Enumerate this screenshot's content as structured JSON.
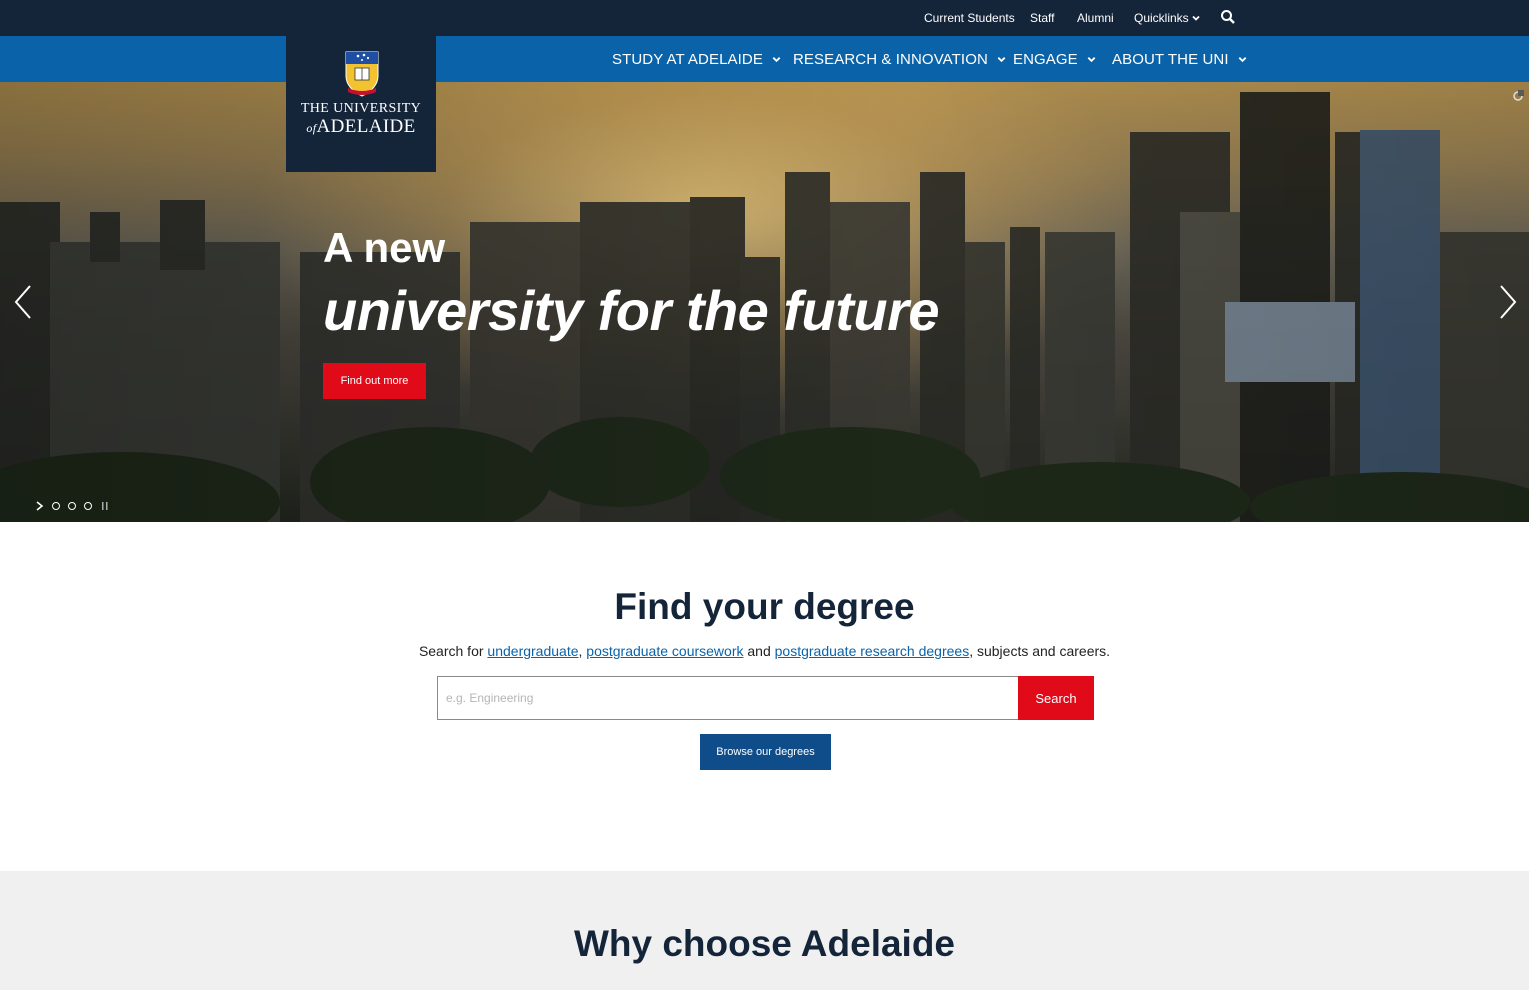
{
  "utility_nav": {
    "links": [
      "Current Students",
      "Staff",
      "Alumni"
    ],
    "quicklinks_label": "Quicklinks",
    "icons": [
      "chevron-down-icon",
      "search-icon"
    ]
  },
  "logo": {
    "line1": "THE UNIVERSITY",
    "line2_prefix": "of",
    "line2": "ADELAIDE"
  },
  "main_nav": {
    "items": [
      {
        "label": "STUDY AT ADELAIDE"
      },
      {
        "label": "RESEARCH & INNOVATION"
      },
      {
        "label": "ENGAGE"
      },
      {
        "label": "ABOUT THE UNI"
      }
    ]
  },
  "hero": {
    "title_line1": "A new",
    "title_line2": "university for the future",
    "button_label": "Find out more",
    "pager_count": 3,
    "icons": [
      "chevron-left-icon",
      "chevron-right-icon",
      "play-icon",
      "pause-icon"
    ]
  },
  "degree": {
    "title": "Find your degree",
    "desc_prefix": "Search for ",
    "link_undergraduate": "undergraduate",
    "sep1": ", ",
    "link_pg_coursework": "postgraduate coursework",
    "sep2": " and ",
    "link_pg_research": "postgraduate research degrees",
    "desc_suffix": ", subjects and careers.",
    "search_placeholder": "e.g. Engineering",
    "search_button": "Search",
    "browse_button": "Browse our degrees"
  },
  "why": {
    "title": "Why choose Adelaide"
  },
  "colors": {
    "top_bar": "#14253a",
    "nav_bar": "#0a63a9",
    "accent_red": "#e10a19",
    "browse_blue": "#0f4d8a",
    "why_bg": "#f0f0f0"
  }
}
